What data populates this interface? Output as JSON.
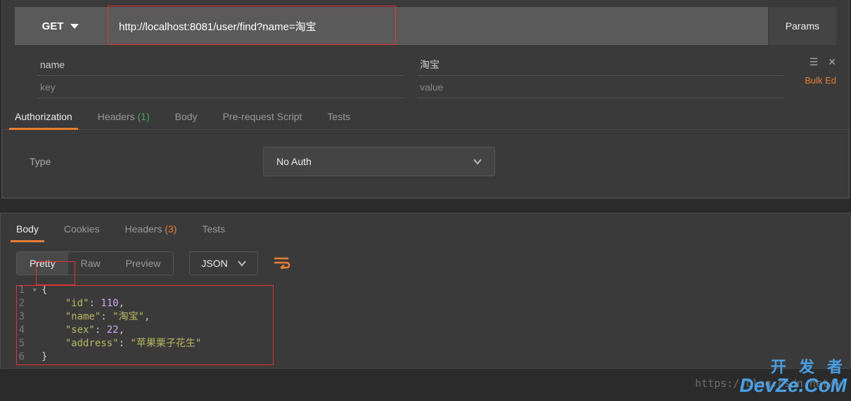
{
  "request": {
    "method": "GET",
    "url": "http://localhost:8081/user/find?name=淘宝",
    "params_button": "Params"
  },
  "params": {
    "key_header": "name",
    "value_header": "淘宝",
    "key_placeholder": "key",
    "value_placeholder": "value",
    "bulk_edit": "Bulk Ed"
  },
  "req_tabs": {
    "authorization": "Authorization",
    "headers": "Headers",
    "headers_count": "(1)",
    "body": "Body",
    "prerequest": "Pre-request Script",
    "tests": "Tests"
  },
  "auth": {
    "type_label": "Type",
    "selected": "No Auth"
  },
  "resp_tabs": {
    "body": "Body",
    "cookies": "Cookies",
    "headers": "Headers",
    "headers_count": "(3)",
    "tests": "Tests"
  },
  "view_modes": {
    "pretty": "Pretty",
    "raw": "Raw",
    "preview": "Preview",
    "format": "JSON"
  },
  "response_body": {
    "id_key": "\"id\"",
    "id_val": "110",
    "name_key": "\"name\"",
    "name_val": "\"淘宝\"",
    "sex_key": "\"sex\"",
    "sex_val": "22",
    "address_key": "\"address\"",
    "address_val": "\"苹果栗子花生\""
  },
  "watermark": "https://blog.csdn.net/w",
  "logo": {
    "zh": "开 发 者",
    "en": "DevZe.CoM"
  }
}
